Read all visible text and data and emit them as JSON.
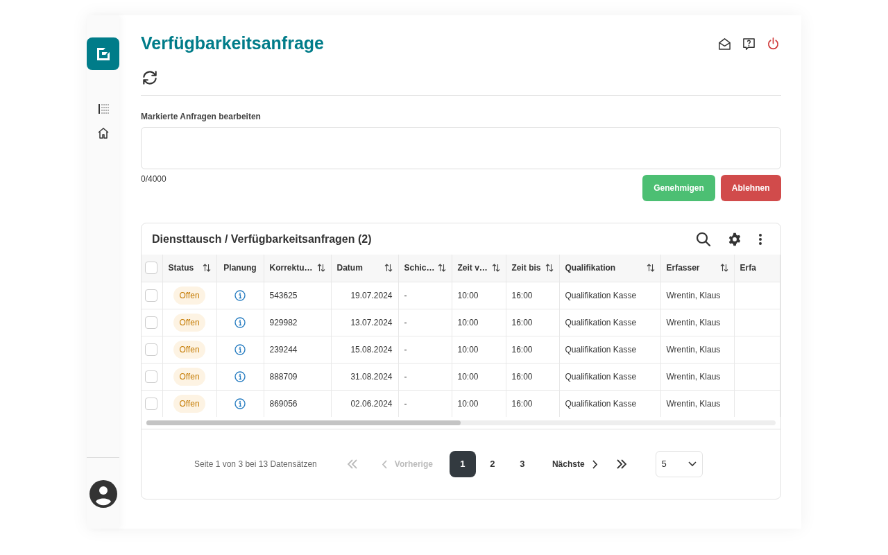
{
  "page_title": "Verfügbarkeitsanfrage",
  "comment": {
    "label": "Markierte Anfragen bearbeiten",
    "counter": "0/4000"
  },
  "actions": [
    {
      "label": "Genehmigen",
      "kind": "approve"
    },
    {
      "label": "Ablehnen",
      "kind": "reject"
    }
  ],
  "table": {
    "title": "Diensttausch / Verfügbarkeitsanfragen (2)",
    "select_all_checked": false,
    "columns": [
      {
        "label": "Status",
        "sortable": true
      },
      {
        "label": "Planung",
        "sortable": false
      },
      {
        "label": "Korrektu…",
        "sortable": true
      },
      {
        "label": "Datum",
        "sortable": true
      },
      {
        "label": "Schic…",
        "sortable": true
      },
      {
        "label": "Zeit v…",
        "sortable": true
      },
      {
        "label": "Zeit bis",
        "sortable": true
      },
      {
        "label": "Qualifikation",
        "sortable": true
      },
      {
        "label": "Erfasser",
        "sortable": true
      },
      {
        "label": "Erfa",
        "sortable": false
      }
    ],
    "rows": [
      {
        "checked": false,
        "status": "Offen",
        "korrektur": "543625",
        "datum": "19.07.2024",
        "schicht": "-",
        "zeit_von": "10:00",
        "zeit_bis": "16:00",
        "qualifikation": "Qualifikation Kasse",
        "erfasser": "Wrentin, Klaus"
      },
      {
        "checked": false,
        "status": "Offen",
        "korrektur": "929982",
        "datum": "13.07.2024",
        "schicht": "-",
        "zeit_von": "10:00",
        "zeit_bis": "16:00",
        "qualifikation": "Qualifikation Kasse",
        "erfasser": "Wrentin, Klaus"
      },
      {
        "checked": false,
        "status": "Offen",
        "korrektur": "239244",
        "datum": "15.08.2024",
        "schicht": "-",
        "zeit_von": "10:00",
        "zeit_bis": "16:00",
        "qualifikation": "Qualifikation Kasse",
        "erfasser": "Wrentin, Klaus"
      },
      {
        "checked": false,
        "status": "Offen",
        "korrektur": "888709",
        "datum": "31.08.2024",
        "schicht": "-",
        "zeit_von": "10:00",
        "zeit_bis": "16:00",
        "qualifikation": "Qualifikation Kasse",
        "erfasser": "Wrentin, Klaus"
      },
      {
        "checked": false,
        "status": "Offen",
        "korrektur": "869056",
        "datum": "02.06.2024",
        "schicht": "-",
        "zeit_von": "10:00",
        "zeit_bis": "16:00",
        "qualifikation": "Qualifikation Kasse",
        "erfasser": "Wrentin, Klaus"
      }
    ]
  },
  "pagination": {
    "summary": "Seite 1 von 3 bei 13 Datensätzen",
    "first_disabled": true,
    "previous": {
      "label": "Vorherige",
      "disabled": true
    },
    "pages": [
      {
        "label": "1",
        "selected": true
      },
      {
        "label": "2",
        "selected": false
      },
      {
        "label": "3",
        "selected": false
      }
    ],
    "next": {
      "label": "Nächste",
      "disabled": false
    },
    "last_disabled": false,
    "page_size": "5"
  }
}
